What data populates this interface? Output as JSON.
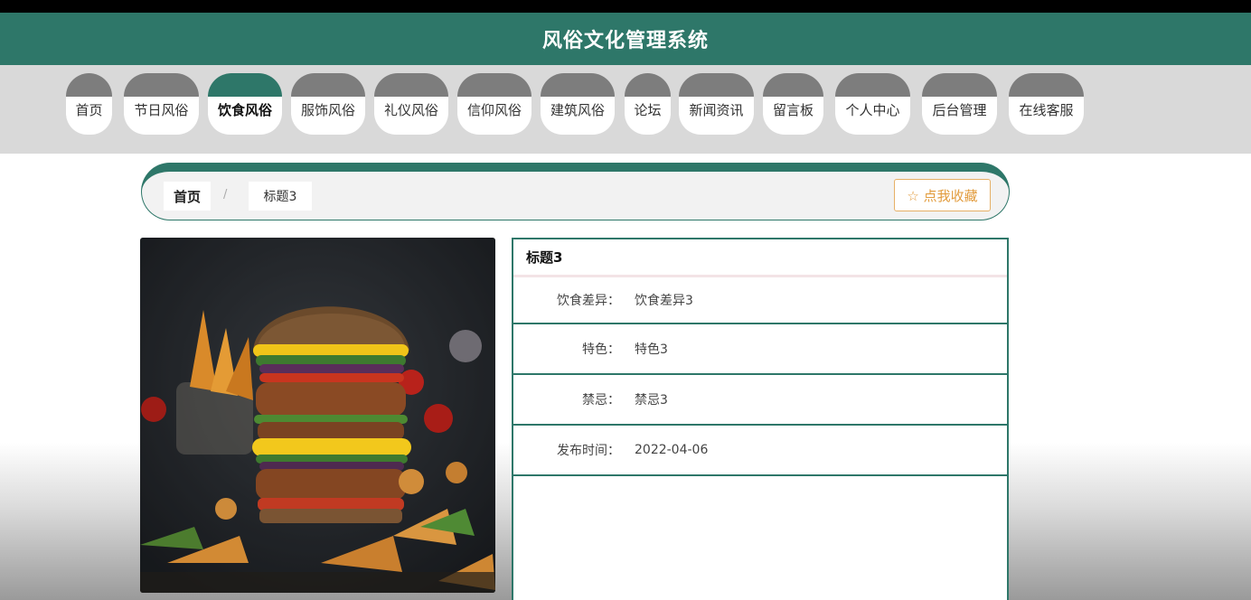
{
  "header": {
    "title": "风俗文化管理系统"
  },
  "nav": {
    "items": [
      {
        "label": "首页"
      },
      {
        "label": "节日风俗"
      },
      {
        "label": "饮食风俗"
      },
      {
        "label": "服饰风俗"
      },
      {
        "label": "礼仪风俗"
      },
      {
        "label": "信仰风俗"
      },
      {
        "label": "建筑风俗"
      },
      {
        "label": "论坛"
      },
      {
        "label": "新闻资讯"
      },
      {
        "label": "留言板"
      },
      {
        "label": "个人中心"
      },
      {
        "label": "后台管理"
      },
      {
        "label": "在线客服"
      }
    ],
    "active": "饮食风俗"
  },
  "breadcrumb": {
    "home": "首页",
    "separator": "/",
    "current": "标题3"
  },
  "favorite": {
    "label": "☆ 点我收藏"
  },
  "detail": {
    "title": "标题3",
    "rows": [
      {
        "label": "饮食差异：",
        "value": "饮食差异3"
      },
      {
        "label": "特色：",
        "value": "特色3"
      },
      {
        "label": "禁忌：",
        "value": "禁忌3"
      },
      {
        "label": "发布时间：",
        "value": "2022-04-06"
      }
    ]
  },
  "colors": {
    "primary": "#2e7769",
    "nav_cap": "#7d7d7d",
    "accent": "#e29c3e"
  }
}
